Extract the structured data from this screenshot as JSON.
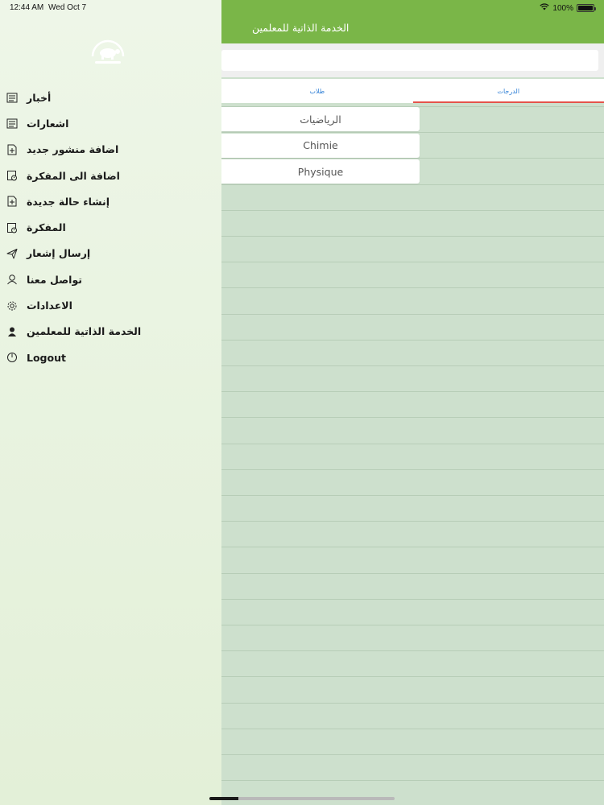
{
  "status": {
    "time": "12:44 AM",
    "date": "Wed Oct 7",
    "battery": "100%",
    "battery_level": 1.0
  },
  "sidebar": {
    "logo_icon": "turtle-logo-icon",
    "items": [
      {
        "label": "أخبار",
        "icon": "news-icon"
      },
      {
        "label": "اشعارات",
        "icon": "notifications-icon"
      },
      {
        "label": "اضافة منشور جديد",
        "icon": "add-post-icon"
      },
      {
        "label": "اضافة الى المفكرة",
        "icon": "add-to-notebook-icon"
      },
      {
        "label": "إنشاء حالة جديدة",
        "icon": "new-status-icon"
      },
      {
        "label": "المفكرة",
        "icon": "notebook-icon"
      },
      {
        "label": "إرسال إشعار",
        "icon": "send-icon"
      },
      {
        "label": "تواصل معنا",
        "icon": "contact-icon"
      },
      {
        "label": "الاعدادات",
        "icon": "settings-icon"
      },
      {
        "label": "الخدمة الذاتية للمعلمين",
        "icon": "teacher-icon"
      },
      {
        "label": "Logout",
        "icon": "power-icon"
      }
    ]
  },
  "header": {
    "title": "الخدمة الذاتية للمعلمين"
  },
  "search": {
    "value": "",
    "placeholder": ""
  },
  "tabs": [
    {
      "label": "طلاب",
      "active": false
    },
    {
      "label": "الدرجات",
      "active": true
    }
  ],
  "subjects": [
    "الرياضيات",
    "Chimie",
    "Physique"
  ],
  "colors": {
    "header": "#7ab648",
    "sidebar": "#e7f2de",
    "content": "#cde0cd",
    "tab_text": "#2f7fd6",
    "tab_indicator": "#e5534b"
  }
}
